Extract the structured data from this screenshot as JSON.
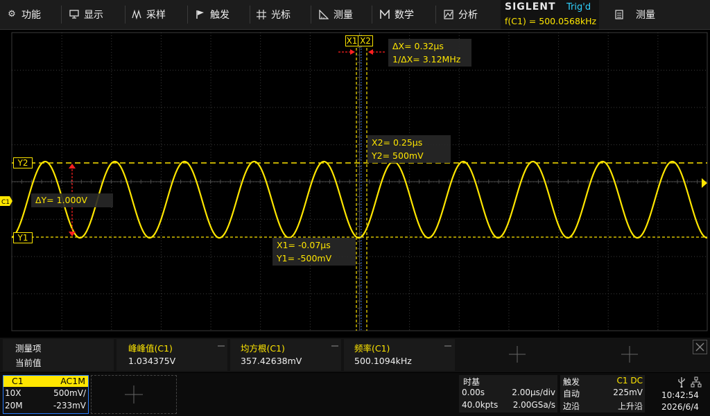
{
  "menu": {
    "items": [
      {
        "id": "function",
        "label": "功能",
        "icon": "gear-icon"
      },
      {
        "id": "display",
        "label": "显示",
        "icon": "monitor-icon"
      },
      {
        "id": "acquire",
        "label": "采样",
        "icon": "wave-icon"
      },
      {
        "id": "trigger",
        "label": "触发",
        "icon": "flag-icon"
      },
      {
        "id": "cursor",
        "label": "光标",
        "icon": "crosshair-icon"
      },
      {
        "id": "measure",
        "label": "测量",
        "icon": "ruler-icon"
      },
      {
        "id": "math",
        "label": "数学",
        "icon": "m-icon"
      },
      {
        "id": "analyze",
        "label": "分析",
        "icon": "analyze-icon"
      },
      {
        "id": "measure2",
        "label": "测量",
        "icon": "document-icon"
      }
    ]
  },
  "status": {
    "brand": "SIGLENT",
    "trigger_state": "Trig'd",
    "frequency": "f(C1) = 500.0568kHz"
  },
  "cursors": {
    "x1_tag": "X1",
    "x2_tag": "X2",
    "y1_tag": "Y1",
    "y2_tag": "Y2",
    "channel_tag": "C1",
    "delta_x": "ΔX= 0.32μs",
    "inv_delta_x": "1/ΔX= 3.12MHz",
    "x2_value": "X2= 0.25μs",
    "y2_value": "Y2= 500mV",
    "x1_value": "X1= -0.07μs",
    "y1_value": "Y1= -500mV",
    "delta_y": "ΔY= 1.000V"
  },
  "measurements": {
    "row_header": "测量项",
    "row_current": "当前值",
    "columns": [
      {
        "name": "峰峰值(C1)",
        "value": "1.034375V"
      },
      {
        "name": "均方根(C1)",
        "value": "357.42638mV"
      },
      {
        "name": "频率(C1)",
        "value": "500.1094kHz"
      }
    ]
  },
  "channel": {
    "name": "C1",
    "coupling": "AC1M",
    "probe": "10X",
    "scale": "500mV/",
    "bw": "20M",
    "offset": "-233mV"
  },
  "timebase": {
    "title": "时基",
    "delay": "0.00s",
    "scale": "2.00μs/div",
    "points": "40.0kpts",
    "rate": "2.00GSa/s"
  },
  "trigger": {
    "title": "触发",
    "source": "C1 DC",
    "mode": "自动",
    "level": "225mV",
    "type": "边沿",
    "slope": "上升沿"
  },
  "clock": {
    "time": "10:42:54",
    "date": "2026/6/4"
  },
  "colors": {
    "trace": "#ffe600",
    "accent_blue": "#2a7fff",
    "cursor_arrow": "#ff2020",
    "trig_state": "#2fd1ff"
  }
}
